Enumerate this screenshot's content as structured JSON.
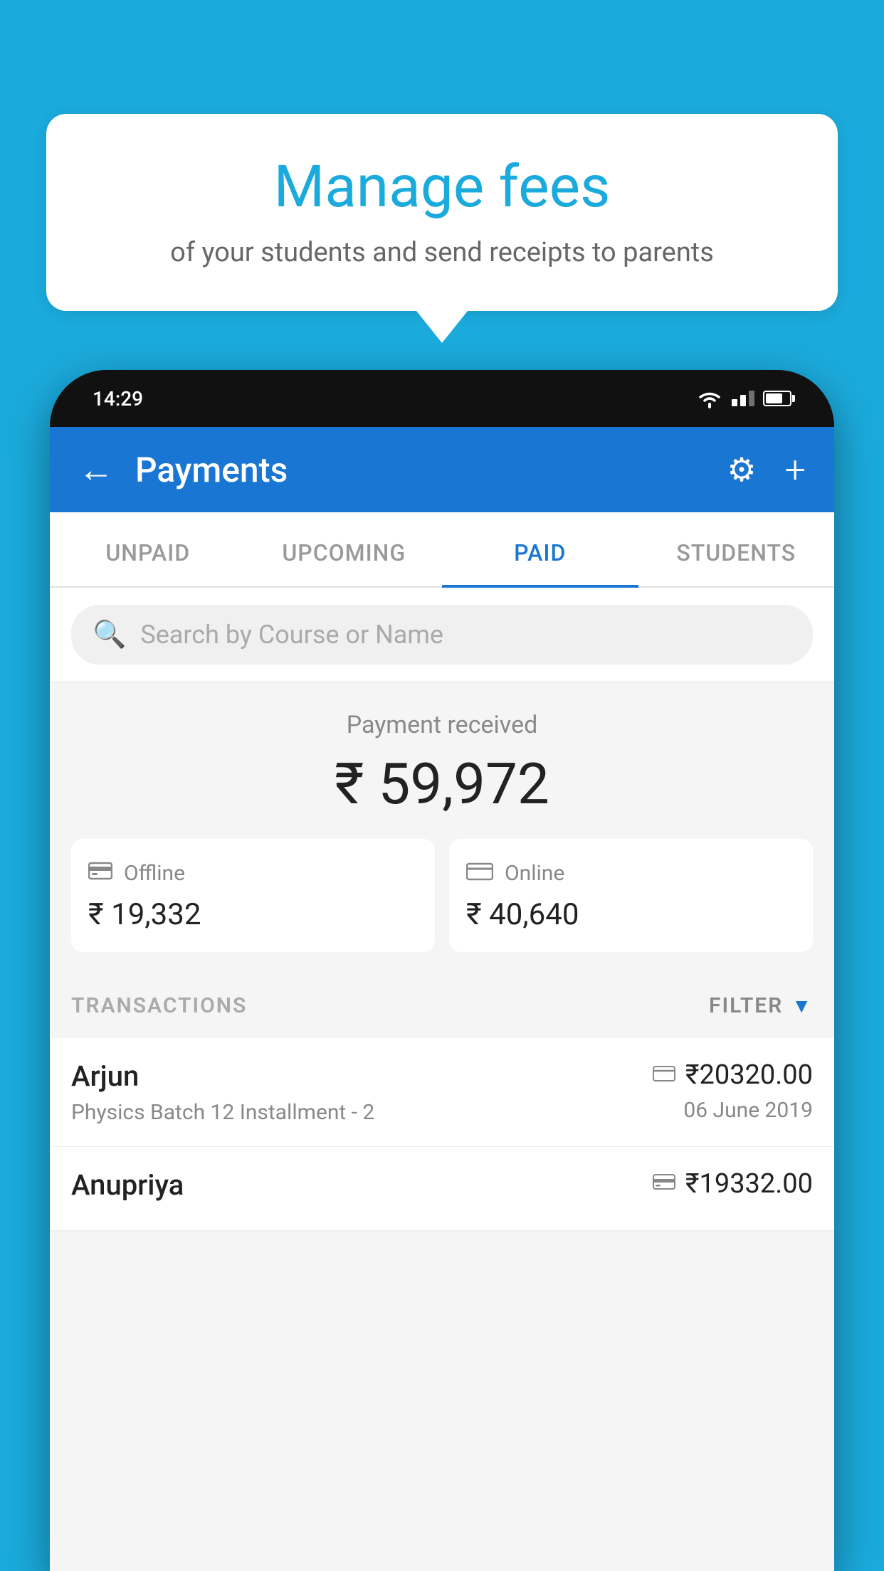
{
  "background_color": "#1BAADC",
  "bubble": {
    "title": "Manage fees",
    "subtitle": "of your students and send receipts to parents"
  },
  "status_bar": {
    "time": "14:29"
  },
  "header": {
    "title": "Payments",
    "back_label": "←",
    "settings_label": "⚙",
    "add_label": "+"
  },
  "tabs": [
    {
      "label": "UNPAID",
      "active": false
    },
    {
      "label": "UPCOMING",
      "active": false
    },
    {
      "label": "PAID",
      "active": true
    },
    {
      "label": "STUDENTS",
      "active": false
    }
  ],
  "search": {
    "placeholder": "Search by Course or Name"
  },
  "payment_summary": {
    "label": "Payment received",
    "total": "₹ 59,972",
    "offline_label": "Offline",
    "offline_amount": "₹ 19,332",
    "online_label": "Online",
    "online_amount": "₹ 40,640"
  },
  "transactions_section": {
    "label": "TRANSACTIONS",
    "filter_label": "FILTER"
  },
  "transactions": [
    {
      "name": "Arjun",
      "course": "Physics Batch 12 Installment - 2",
      "amount": "₹20320.00",
      "date": "06 June 2019",
      "payment_type": "online"
    },
    {
      "name": "Anupriya",
      "course": "",
      "amount": "₹19332.00",
      "date": "",
      "payment_type": "offline"
    }
  ]
}
